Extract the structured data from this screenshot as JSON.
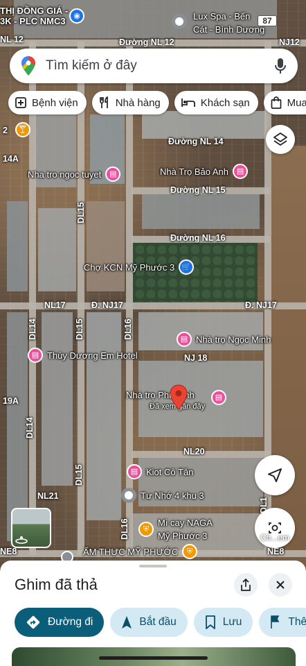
{
  "top_labels": {
    "left_poi": "THỊ ĐỒNG GIÁ -\n3K - PLC NMC3",
    "right_poi": "Lux Spa - Bến\nCát - Bình Dương",
    "route_badge": "87"
  },
  "search": {
    "placeholder": "Tìm kiếm ở đây"
  },
  "chips": [
    {
      "icon": "hospital-icon",
      "label": "Bệnh viện"
    },
    {
      "icon": "restaurant-icon",
      "label": "Nhà hàng"
    },
    {
      "icon": "hotel-icon",
      "label": "Khách sạn"
    },
    {
      "icon": "shopping-icon",
      "label": "Mua"
    }
  ],
  "streets": {
    "nl12": "Đường NL 12",
    "nl12_left": "NL 12",
    "nj12": "NJ12",
    "nl14": "Đường NL 14",
    "nl15": "Đường NL 15",
    "nl16": "Đường NL 16",
    "nl17": "NL17",
    "dnj17": "Đ. NJ17",
    "dnj17_right": "Đ. NJ17",
    "nj18": "NJ 18",
    "nl20": "NL20",
    "nl21": "NL21",
    "ne8_left": "NE8",
    "ne8_right": "NE8",
    "dl15_top": "DL15",
    "dl14": "DL14",
    "dl15_mid": "DL15",
    "dl16_mid": "DL16",
    "dl14_low": "DL14",
    "dl15_low": "DL15",
    "dl16_low": "DL16",
    "dl1": "DL1",
    "a14": "14A",
    "a19": "19A",
    "two": "2"
  },
  "pois": {
    "nha_tro_ngoc_tuyet": "Nha tro ngoc tuyet",
    "nha_tro_bao_anh": "Nhà Trọ Bảo Anh",
    "cho_kcn": "Chợ KCN Mỹ Phước 3",
    "nha_tro_ngoc_minh": "Nhà trọ Ngọc Minh",
    "thuy_duong": "Thùy Dương Em Hotel",
    "nha_tro_phu_vinh": "Nhà trọ Phú Vinh",
    "recently_viewed": "Đã xem gần đây",
    "kiot_co_tan": "Kiot Cô Tân",
    "tu_nho": "Tư Nhớ 4 khu 3",
    "mi_cay": "Mì cay NAGA\nMỹ Phước 3",
    "am_thuc": "ẨM THỰC MỸ PHƯỚC"
  },
  "controls": {
    "layers_icon": "layers-icon",
    "locate_icon": "navigation-arrow-icon",
    "chat_label": "Ch...em"
  },
  "sheet": {
    "title": "Ghim đã thả",
    "actions": [
      {
        "icon": "directions-icon",
        "label": "Đường đi"
      },
      {
        "icon": "start-arrow-icon",
        "label": "Bắt đầu"
      },
      {
        "icon": "bookmark-icon",
        "label": "Lưu"
      },
      {
        "icon": "flag-icon",
        "label": "Thê"
      }
    ]
  },
  "colors": {
    "poi_pink": "#e8519c",
    "poi_blue": "#1a73e8",
    "pin_red": "#ea4335",
    "primary_action": "#0b5e79",
    "secondary_action": "#d3e9f3"
  }
}
